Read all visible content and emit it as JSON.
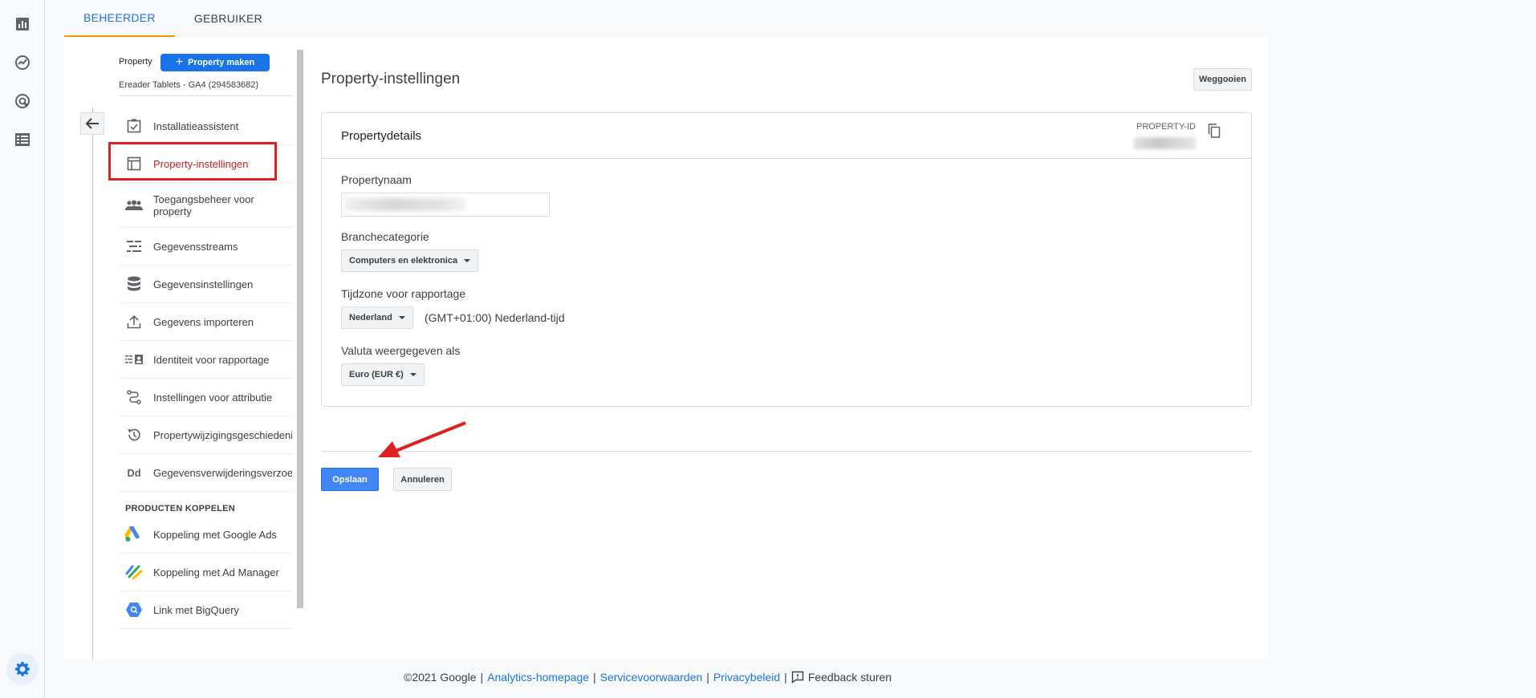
{
  "tabs": [
    {
      "label": "BEHEERDER"
    },
    {
      "label": "GEBRUIKER"
    }
  ],
  "property_selector": {
    "label": "Property",
    "create_label": "Property maken",
    "account": "Ereader Tablets - GA4 (294583682)"
  },
  "nav": {
    "items": [
      {
        "label": "Installatieassistent",
        "icon": "checklist-icon"
      },
      {
        "label": "Property-instellingen",
        "icon": "property-window-icon"
      },
      {
        "label": "Toegangsbeheer voor property",
        "icon": "people-icon"
      },
      {
        "label": "Gegevensstreams",
        "icon": "streams-icon"
      },
      {
        "label": "Gegevensinstellingen",
        "icon": "database-icon"
      },
      {
        "label": "Gegevens importeren",
        "icon": "upload-icon"
      },
      {
        "label": "Identiteit voor rapportage",
        "icon": "identity-icon"
      },
      {
        "label": "Instellingen voor attributie",
        "icon": "attribution-icon"
      },
      {
        "label": "Propertywijzigingsgeschiedenis",
        "icon": "history-icon"
      },
      {
        "label": "Gegevensverwijderingsverzoeken",
        "icon": "data-deletion-icon",
        "icon_text": "Dd"
      }
    ],
    "section_title": "PRODUCTEN KOPPELEN",
    "links": [
      {
        "label": "Koppeling met Google Ads",
        "icon": "google-ads-icon"
      },
      {
        "label": "Koppeling met Ad Manager",
        "icon": "ad-manager-icon"
      },
      {
        "label": "Link met BigQuery",
        "icon": "bigquery-icon"
      }
    ]
  },
  "main": {
    "title": "Property-instellingen",
    "discard_label": "Weggooien",
    "card_title": "Propertydetails",
    "property_id_label": "PROPERTY-ID",
    "fields": {
      "name_label": "Propertynaam",
      "industry_label": "Branchecategorie",
      "industry_value": "Computers en elektronica",
      "timezone_label": "Tijdzone voor rapportage",
      "timezone_country": "Nederland",
      "timezone_text": "(GMT+01:00) Nederland-tijd",
      "currency_label": "Valuta weergegeven als",
      "currency_value": "Euro (EUR €)"
    },
    "save_label": "Opslaan",
    "cancel_label": "Annuleren"
  },
  "footer": {
    "copyright": "©2021 Google",
    "links": [
      "Analytics-homepage",
      "Servicevoorwaarden",
      "Privacybeleid"
    ],
    "feedback": "Feedback sturen"
  },
  "colors": {
    "accent": "#1a73e8",
    "active_nav": "#c5221f",
    "highlight": "#e02020",
    "tab_underline": "#f29900"
  }
}
